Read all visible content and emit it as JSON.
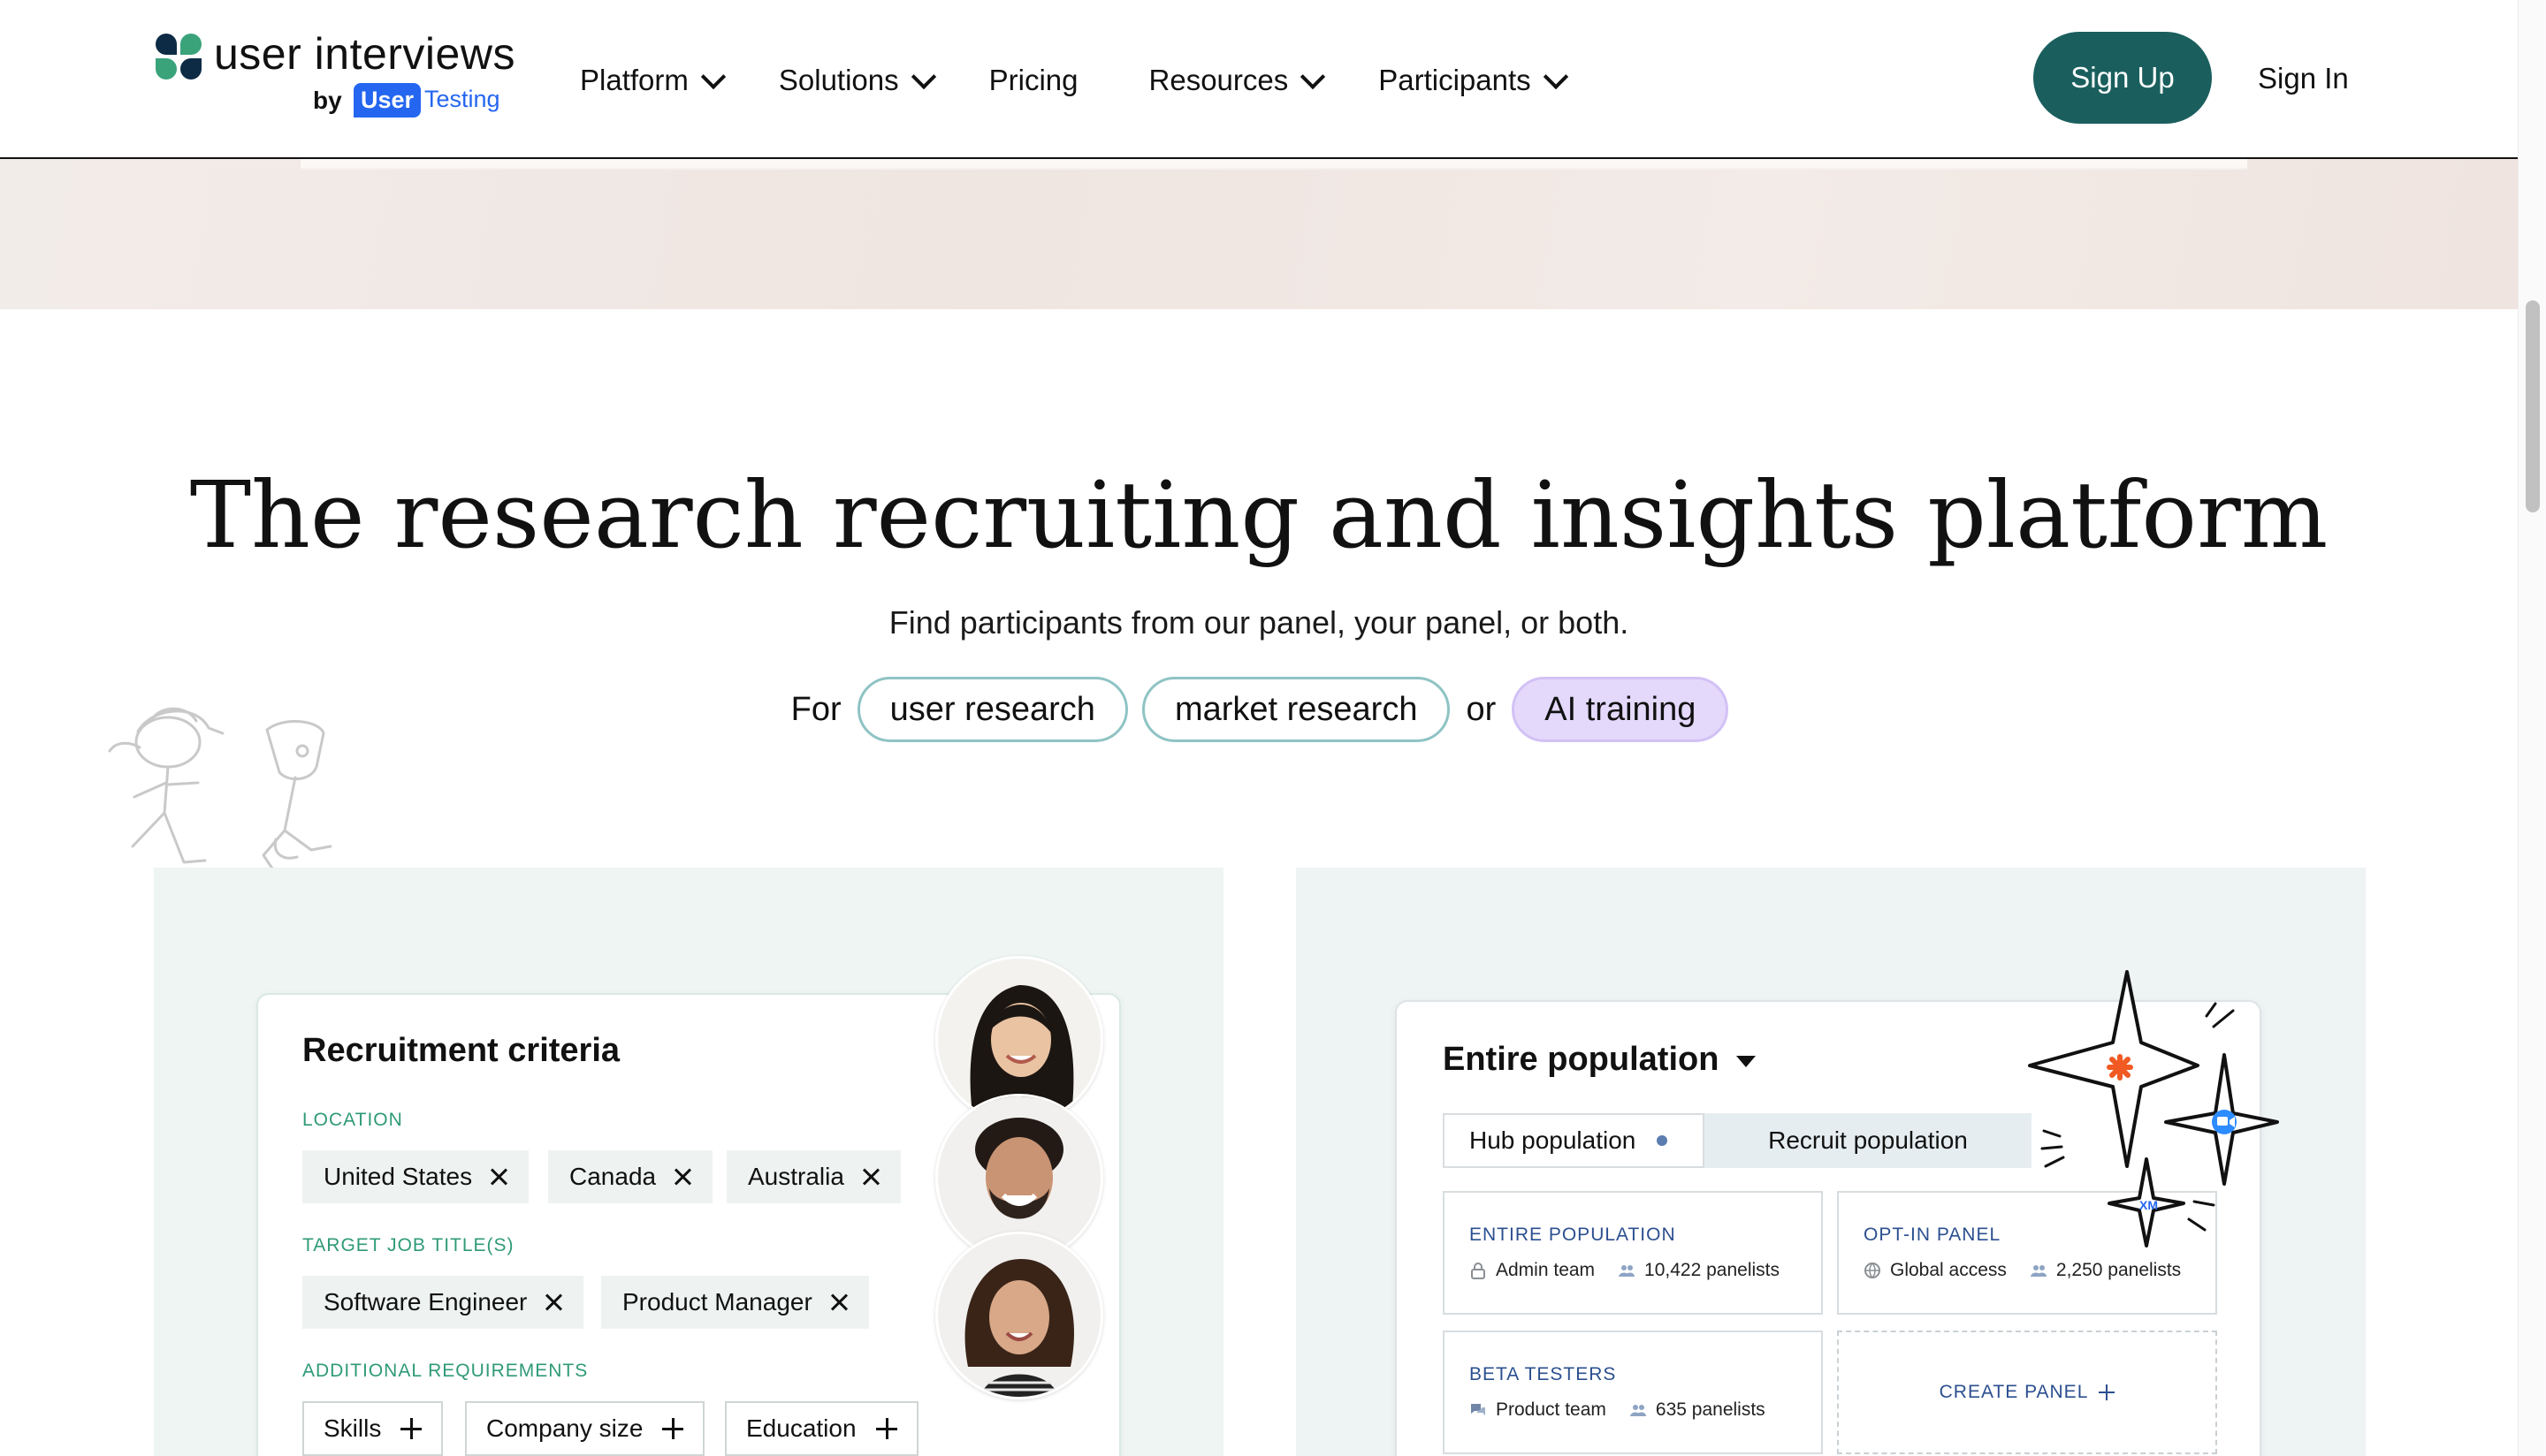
{
  "header": {
    "logo": {
      "name": "user interviews",
      "by": "by",
      "user": "User",
      "testing": "Testing"
    },
    "nav": [
      {
        "label": "Platform",
        "has_menu": true
      },
      {
        "label": "Solutions",
        "has_menu": true
      },
      {
        "label": "Pricing",
        "has_menu": false
      },
      {
        "label": "Resources",
        "has_menu": true
      },
      {
        "label": "Participants",
        "has_menu": true
      }
    ],
    "signup_label": "Sign Up",
    "signin_label": "Sign In"
  },
  "hero": {
    "title": "The research recruiting and insights platform",
    "subtitle": "Find participants from our panel, your panel, or both.",
    "for_word": "For",
    "or_word": "or",
    "pills": [
      "user research",
      "market research",
      "AI training"
    ]
  },
  "recruitment_card": {
    "title": "Recruitment criteria",
    "location_label": "LOCATION",
    "locations": [
      "United States",
      "Canada",
      "Australia"
    ],
    "job_label": "TARGET JOB TITLE(S)",
    "jobs": [
      "Software Engineer",
      "Product Manager"
    ],
    "additional_label": "ADDITIONAL REQUIREMENTS",
    "additional": [
      "Skills",
      "Company size",
      "Education"
    ]
  },
  "population_card": {
    "title": "Entire population",
    "segments": [
      "Hub population",
      "Recruit population"
    ],
    "panels": [
      {
        "title": "ENTIRE POPULATION",
        "owner": "Admin team",
        "count": "10,422 panelists",
        "owner_icon": "lock-icon"
      },
      {
        "title": "OPT-IN PANEL",
        "owner": "Global access",
        "count": "2,250 panelists",
        "owner_icon": "globe-icon"
      },
      {
        "title": "BETA TESTERS",
        "owner": "Product team",
        "count": "635 panelists",
        "owner_icon": "chat-icon"
      }
    ],
    "create_label": "CREATE PANEL",
    "xm_label": "XM"
  },
  "colors": {
    "brand_teal": "#1a5f5e",
    "accent_green": "#2f9a78",
    "panel_blue": "#2b4f8f",
    "ai_pill": "#e4d9fb",
    "usertesting_blue": "#2466f0"
  }
}
